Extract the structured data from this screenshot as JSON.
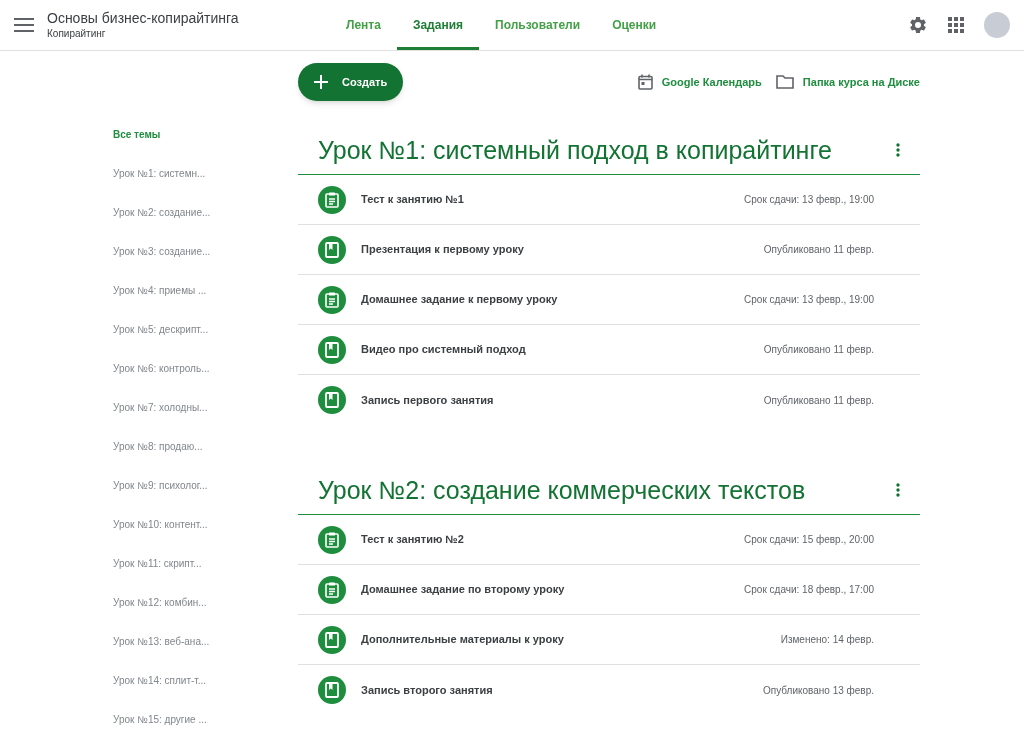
{
  "header": {
    "title": "Основы бизнес-копирайтинга",
    "subtitle": "Копирайтинг"
  },
  "tabs": [
    {
      "label": "Лента",
      "selected": false
    },
    {
      "label": "Задания",
      "selected": true
    },
    {
      "label": "Пользователи",
      "selected": false
    },
    {
      "label": "Оценки",
      "selected": false
    }
  ],
  "create_button": {
    "label": "Создать"
  },
  "links": [
    {
      "kind": "calendar",
      "label": "Google Календарь"
    },
    {
      "kind": "folder",
      "label": "Папка курса на Диске"
    }
  ],
  "sidebar": {
    "items": [
      {
        "label": "Все темы",
        "selected": true
      },
      {
        "label": "Урок №1: системн...",
        "selected": false
      },
      {
        "label": "Урок №2: создание...",
        "selected": false
      },
      {
        "label": "Урок №3: создание...",
        "selected": false
      },
      {
        "label": "Урок №4: приемы ...",
        "selected": false
      },
      {
        "label": "Урок №5: дескрипт...",
        "selected": false
      },
      {
        "label": "Урок №6: контроль...",
        "selected": false
      },
      {
        "label": "Урок №7: холодны...",
        "selected": false
      },
      {
        "label": "Урок №8: продаю...",
        "selected": false
      },
      {
        "label": "Урок №9: психолог...",
        "selected": false
      },
      {
        "label": "Урок №10: контент...",
        "selected": false
      },
      {
        "label": "Урок №11: скрипт...",
        "selected": false
      },
      {
        "label": "Урок №12: комбин...",
        "selected": false
      },
      {
        "label": "Урок №13: веб-ана...",
        "selected": false
      },
      {
        "label": "Урок №14: сплит-т...",
        "selected": false
      },
      {
        "label": "Урок №15: другие ...",
        "selected": false
      }
    ]
  },
  "topics": [
    {
      "title": "Урок №1: системный подход в копирайтинге",
      "items": [
        {
          "kind": "assignment",
          "title": "Тест к занятию №1",
          "meta": "Срок сдачи: 13 февр., 19:00"
        },
        {
          "kind": "material",
          "title": "Презентация к первому уроку",
          "meta": "Опубликовано 11 февр."
        },
        {
          "kind": "assignment",
          "title": "Домашнее задание к первому уроку",
          "meta": "Срок сдачи: 13 февр., 19:00"
        },
        {
          "kind": "material",
          "title": "Видео про системный подход",
          "meta": "Опубликовано 11 февр."
        },
        {
          "kind": "material",
          "title": "Запись первого занятия",
          "meta": "Опубликовано 11 февр."
        }
      ]
    },
    {
      "title": "Урок №2: создание коммерческих текстов",
      "items": [
        {
          "kind": "assignment",
          "title": "Тест к занятию №2",
          "meta": "Срок сдачи: 15 февр., 20:00"
        },
        {
          "kind": "assignment",
          "title": "Домашнее задание по второму уроку",
          "meta": "Срок сдачи: 18 февр., 17:00"
        },
        {
          "kind": "material",
          "title": "Дополнительные материалы к уроку",
          "meta": "Изменено: 14 февр."
        },
        {
          "kind": "material",
          "title": "Запись второго занятия",
          "meta": "Опубликовано 13 февр."
        }
      ]
    }
  ]
}
